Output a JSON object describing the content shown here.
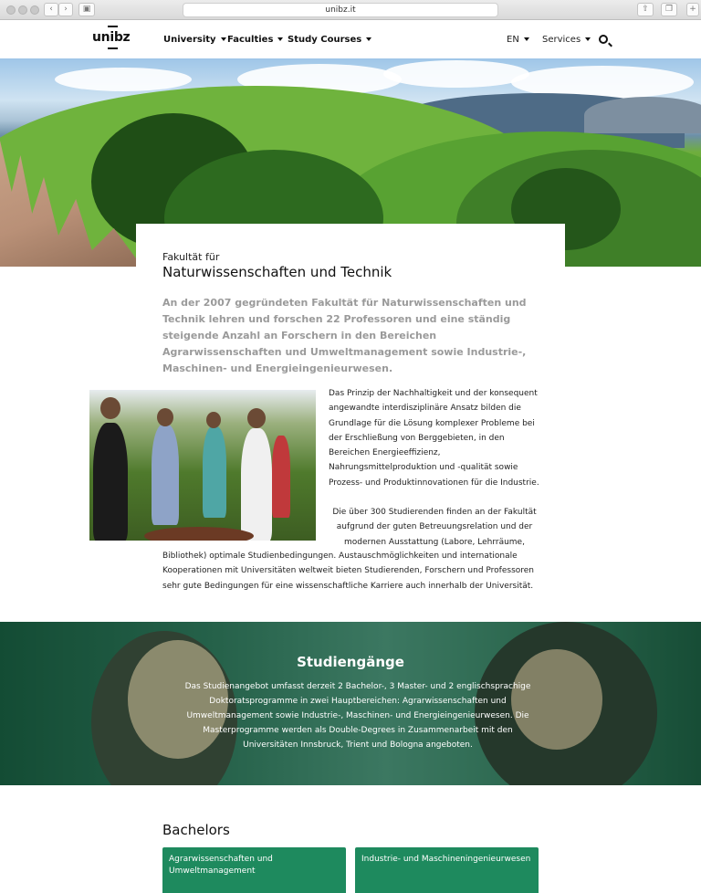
{
  "browser": {
    "url": "unibz.it"
  },
  "nav": {
    "logo": "unibz",
    "items": [
      {
        "label": "University"
      },
      {
        "label": "Faculties"
      },
      {
        "label": "Study Courses"
      }
    ],
    "language": "EN",
    "services": "Services"
  },
  "faculty": {
    "subtitle": "Fakultät für",
    "title": "Naturwissenschaften und Technik",
    "lead": "An der 2007 gegründeten Fakultät für Naturwissenschaften und Technik lehren und forschen 22 Professoren und eine ständig steigende Anzahl an Forschern in den Bereichen Agrarwissenschaften und Umweltmanagement sowie Industrie-, Maschinen- und Energieingenieurwesen.",
    "para1": "Das Prinzip der Nachhaltigkeit und der konsequent angewandte interdisziplinäre Ansatz bilden die Grundlage für die Lösung komplexer Probleme bei der Erschließung von Berggebieten, in den Bereichen Energieeffizienz, Nahrungsmittelproduktion und -qualität sowie Prozess- und Produktinnovationen für die Industrie.",
    "para2_a": "Die über 300 Studierenden finden an der Fakultät aufgrund der guten Betreuungsrelation und der modernen Ausstattung (Labore, Lehrräume,",
    "para2_b": "Bibliothek) optimale Studienbedingungen. Austauschmöglichkeiten und internationale Kooperationen mit Universitäten weltweit bieten Studierenden, Forschern und Professoren sehr gute Bedingungen für eine wissenschaftliche Karriere auch innerhalb der Universität."
  },
  "studies": {
    "title": "Studiengänge",
    "text": "Das Studienangebot umfasst derzeit 2 Bachelor-, 3 Master- und 2 englischsprachige Doktoratsprogramme in zwei Hauptbereichen: Agrarwissenschaften und Umweltmanagement sowie Industrie-, Maschinen- und Energieingenieurwesen. Die Masterprogramme werden als Double-Degrees in Zusammenarbeit mit den Universitäten Innsbruck, Trient und Bologna angeboten."
  },
  "bachelors": {
    "heading": "Bachelors",
    "courses": [
      {
        "label": "Agrarwissenschaften und Umweltmanagement"
      },
      {
        "label": "Industrie- und Maschineningenieurwesen"
      }
    ]
  },
  "colors": {
    "accent": "#1e8a5e",
    "lead_text": "#9a9a9a"
  }
}
